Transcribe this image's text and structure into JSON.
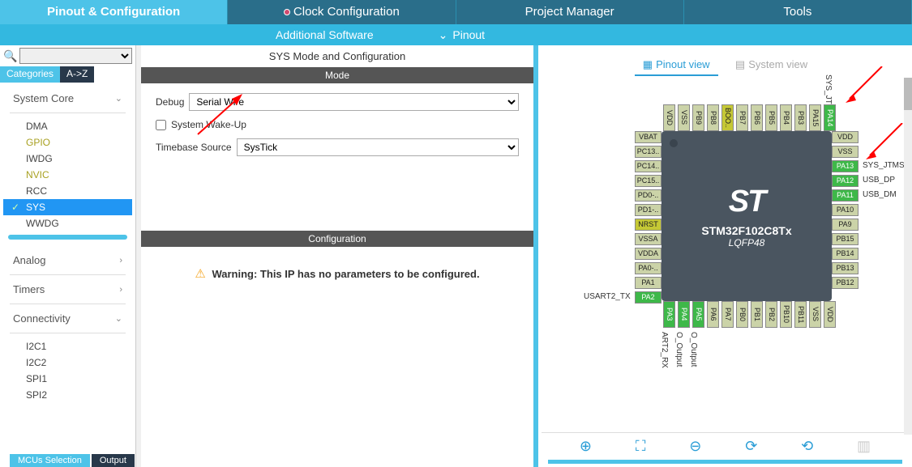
{
  "top_tabs": {
    "pinout": "Pinout & Configuration",
    "clock": "Clock Configuration",
    "project": "Project Manager",
    "tools": "Tools"
  },
  "sub_bar": {
    "additional": "Additional Software",
    "pinout": "Pinout"
  },
  "left": {
    "categories": "Categories",
    "az": "A->Z",
    "sections": {
      "system_core": "System Core",
      "analog": "Analog",
      "timers": "Timers",
      "connectivity": "Connectivity"
    },
    "items": {
      "dma": "DMA",
      "gpio": "GPIO",
      "iwdg": "IWDG",
      "nvic": "NVIC",
      "rcc": "RCC",
      "sys": "SYS",
      "wwdg": "WWDG",
      "i2c1": "I2C1",
      "i2c2": "I2C2",
      "spi1": "SPI1",
      "spi2": "SPI2"
    }
  },
  "middle": {
    "title": "SYS Mode and Configuration",
    "mode": "Mode",
    "debug_label": "Debug",
    "debug_value": "Serial Wire",
    "wakeup": "System Wake-Up",
    "timebase_label": "Timebase Source",
    "timebase_value": "SysTick",
    "config": "Configuration",
    "warning": "Warning: This IP has no parameters to be configured."
  },
  "right": {
    "pinout_view": "Pinout view",
    "system_view": "System view",
    "chip_part": "STM32F102C8Tx",
    "chip_pkg": "LQFP48"
  },
  "pins": {
    "top_rot": "SYS_JT",
    "left": [
      "VBAT",
      "PC13..",
      "PC14..",
      "PC15..",
      "PD0-..",
      "PD1-..",
      "NRST",
      "VSSA",
      "VDDA",
      "PA0-..",
      "PA1",
      "PA2"
    ],
    "left_label": "USART2_TX",
    "right": [
      "VDD",
      "VSS",
      "PA13",
      "PA12",
      "PA11",
      "PA10",
      "PA9",
      "PB15",
      "PB14",
      "PB13",
      "PB12"
    ],
    "right_labels": {
      "pa13": "SYS_JTMS-",
      "pa12": "USB_DP",
      "pa11": "USB_DM"
    },
    "top": [
      "VDD",
      "VSS",
      "PB9",
      "PB8",
      "BOO..",
      "PB7",
      "PB6",
      "PB5",
      "PB4",
      "PB3",
      "PA15",
      "PA14"
    ],
    "bottom": [
      "PA3",
      "PA4",
      "PA5",
      "PA6",
      "PA7",
      "PB0",
      "PB1",
      "PB2",
      "PB10",
      "PB11",
      "VSS",
      "VDD"
    ],
    "bottom_labels": {
      "pa3": "ART2_RX",
      "pa4": "O_Output",
      "pa5": "O_Output"
    }
  },
  "bottom_tabs": {
    "mcus": "MCUs Selection",
    "output": "Output"
  }
}
